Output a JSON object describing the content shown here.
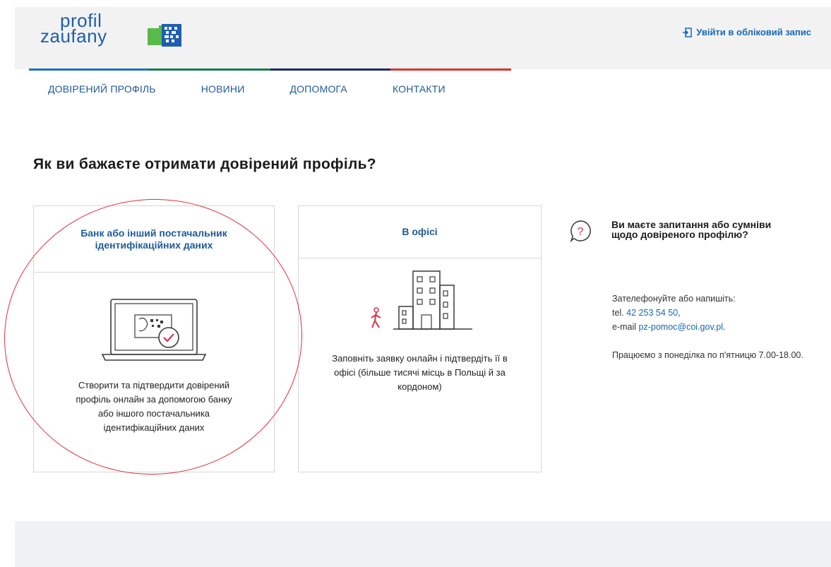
{
  "header": {
    "logo": {
      "line1": "profil",
      "line2": "zaufany"
    },
    "login_label": "Увійти в обліковий запис",
    "stripe_colors": [
      "#1d6fc0",
      "#137a4c",
      "#1a2a6b",
      "#d9342b"
    ]
  },
  "nav": {
    "items": [
      {
        "label": "ДОВІРЕНИЙ ПРОФІЛЬ"
      },
      {
        "label": "НОВИНИ"
      },
      {
        "label": "ДОПОМОГА"
      },
      {
        "label": "КОНТАКТИ"
      }
    ]
  },
  "main": {
    "title": "Як ви бажаєте отримати довірений профіль?",
    "cards": [
      {
        "title": "Банк або інший постачальник ідентифікаційних даних",
        "description": "Створити та підтвердити довірений профіль онлайн за допомогою банку або іншого постачальника ідентифікаційних даних",
        "icon": "laptop-id-icon"
      },
      {
        "title": "В офісі",
        "description": "Заповніть заявку онлайн і підтвердіть її в офісі (більше тисячі місць в Польщі й за кордоном)",
        "icon": "office-building-icon"
      }
    ]
  },
  "help": {
    "title": "Ви маєте запитання або сумніви щодо довіреного профілю?",
    "intro": "Зателефонуйте або напишіть:",
    "tel_prefix": "tel.",
    "tel": "42 253 54 50",
    "email_prefix": "e-mail",
    "email": "pz-pomoc@coi.gov.pl",
    "hours": "Працюємо з понеділка по п'ятницю 7.00-18.00."
  },
  "colors": {
    "accent": "#1467b8",
    "annotation": "#e03038"
  }
}
